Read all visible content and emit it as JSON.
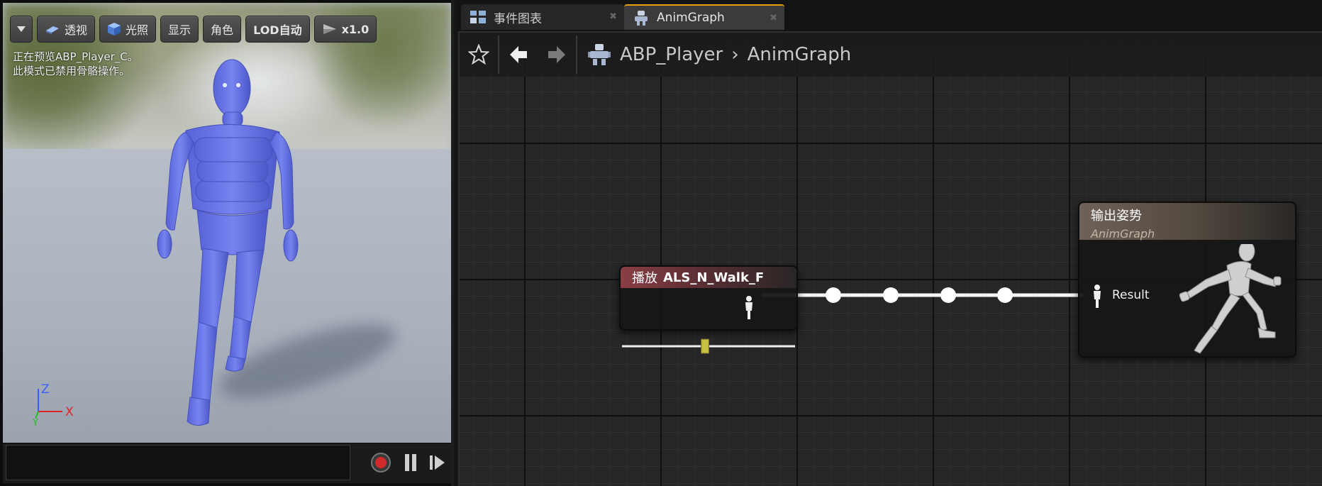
{
  "viewport": {
    "toolbar": {
      "perspective_label": "透视",
      "lighting_label": "光照",
      "show_label": "显示",
      "character_label": "角色",
      "lod_label": "LOD自动",
      "speed_label": "x1.0"
    },
    "info": {
      "line1": "正在预览ABP_Player_C。",
      "line2": "此模式已禁用骨骼操作。"
    },
    "axes": {
      "z": "Z",
      "y": "Y",
      "x": "X"
    },
    "colors": {
      "mannequin": "#6f7ce8",
      "record": "#d02a2a"
    }
  },
  "editor": {
    "tabs": [
      {
        "label": "事件图表",
        "icon": "event-graph-icon"
      },
      {
        "label": "AnimGraph",
        "icon": "anim-graph-icon"
      }
    ],
    "breadcrumb": {
      "root": "ABP_Player",
      "current": "AnimGraph"
    },
    "nodes": {
      "play": {
        "prefix": "播放",
        "asset": "ALS_N_Walk_F",
        "slider_position": 0.48
      },
      "output": {
        "title": "输出姿势",
        "subtitle": "AnimGraph",
        "pin_label": "Result"
      }
    }
  }
}
